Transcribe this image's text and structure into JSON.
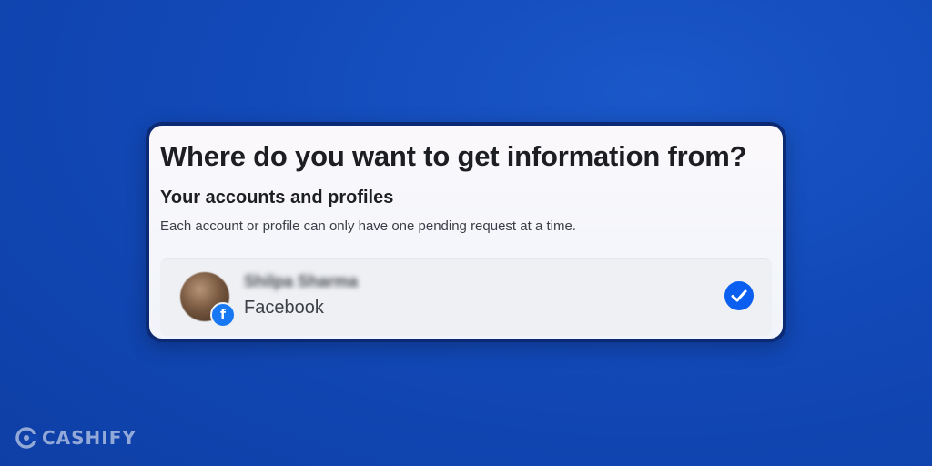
{
  "dialog": {
    "title": "Where do you want to get information from?",
    "section_heading": "Your accounts and profiles",
    "note": "Each account or profile can only have one pending request at a time."
  },
  "account": {
    "name": "Shilpa Sharma",
    "platform": "Facebook",
    "badge_glyph": "f",
    "selected": true
  },
  "watermark": {
    "text": "CASHIFY"
  },
  "colors": {
    "background": "#1249b8",
    "check_blue": "#0a5ff0",
    "facebook_blue": "#1877f2",
    "card_border": "#0b2a73"
  },
  "icons": {
    "selected": "checkmark-circle-icon",
    "platform_badge": "facebook-icon",
    "brand": "cashify-logo-icon"
  }
}
